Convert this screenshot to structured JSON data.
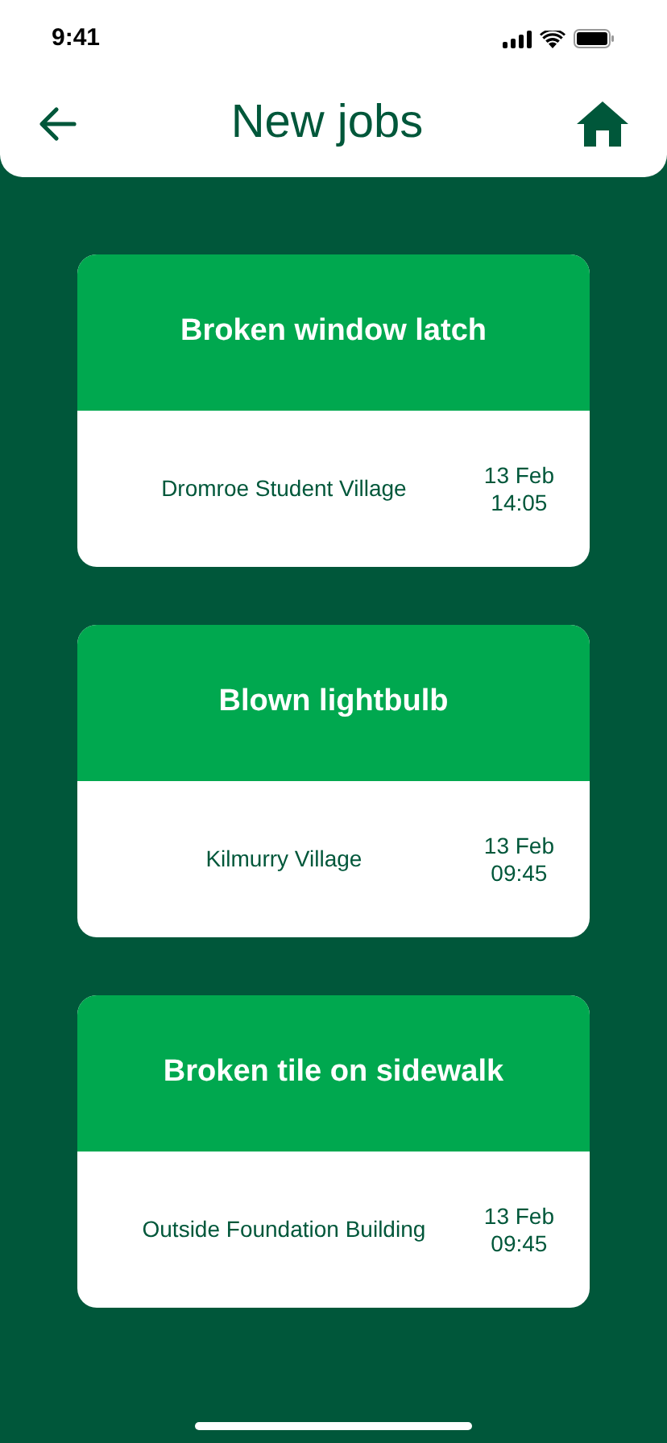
{
  "status_bar": {
    "time": "9:41"
  },
  "header": {
    "title": "New jobs"
  },
  "jobs": [
    {
      "title": "Broken window latch",
      "location": "Dromroe Student Village",
      "date": "13 Feb",
      "time": "14:05"
    },
    {
      "title": "Blown lightbulb",
      "location": "Kilmurry Village",
      "date": "13 Feb",
      "time": "09:45"
    },
    {
      "title": "Broken tile on sidewalk",
      "location": "Outside Foundation Building",
      "date": "13 Feb",
      "time": "09:45"
    }
  ]
}
